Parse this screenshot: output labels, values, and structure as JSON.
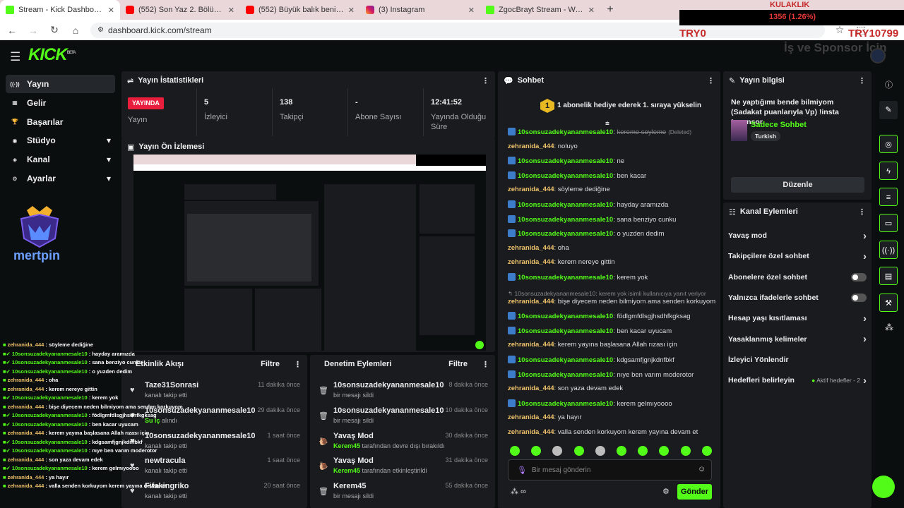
{
  "browser": {
    "tabs": [
      {
        "title": "Stream - Kick Dashboard",
        "favicon": "kick-icon",
        "active": true
      },
      {
        "title": "(552) Son Yaz 2. Bölüm | Sen Ha",
        "favicon": "youtube-icon",
        "active": false
      },
      {
        "title": "(552) Büyük balık benim. #ezel",
        "favicon": "youtube-icon",
        "active": false
      },
      {
        "title": "(3) Instagram",
        "favicon": "instagram-icon",
        "active": false
      },
      {
        "title": "ZgocBrayt Stream - Watch Live",
        "favicon": "kick-icon",
        "active": false
      }
    ],
    "url": "dashboard.kick.com/stream"
  },
  "overlay": {
    "kulaklik": "KULAKLIK",
    "counter": "1356 (1.26%)",
    "try_left": "TRY0",
    "try_right": "TRY10799",
    "sponsor_text": "İş ve Sponsor İçin"
  },
  "sidebar": {
    "items": [
      {
        "label": "Yayın",
        "icon": "broadcast-icon",
        "active": true
      },
      {
        "label": "Gelir",
        "icon": "wallet-icon"
      },
      {
        "label": "Başarılar",
        "icon": "trophy-icon"
      },
      {
        "label": "Stüdyo",
        "icon": "studio-icon",
        "expandable": true
      },
      {
        "label": "Kanal",
        "icon": "channel-icon",
        "expandable": true
      },
      {
        "label": "Ayarlar",
        "icon": "gear-icon",
        "expandable": true
      }
    ],
    "brand": "mertpin"
  },
  "stats": {
    "title": "Yayın İstatistikleri",
    "live_badge": "YAYINDA",
    "live_label": "Yayın",
    "viewers_value": "5",
    "viewers_label": "İzleyici",
    "followers_value": "138",
    "followers_label": "Takipçi",
    "subs_value": "-",
    "subs_label": "Abone Sayısı",
    "duration_value": "12:41:52",
    "duration_label": "Yayında Olduğu Süre"
  },
  "preview": {
    "title": "Yayın Ön İzlemesi"
  },
  "activity": {
    "title": "Etkinlik Akışı",
    "filter": "Filtre",
    "items": [
      {
        "name": "Taze31Sonrasi",
        "sub": "kanalı takip etti",
        "time": "11 dakika önce",
        "icon": "heart-icon"
      },
      {
        "name": "10sonsuzadekyananmesale10",
        "sub_green": "Su iç",
        "sub": " alındı",
        "time": "29 dakika önce",
        "icon": "heart-icon"
      },
      {
        "name": "10sonsuzadekyananmesale10",
        "sub": "kanalı takip etti",
        "time": "1 saat önce",
        "icon": "heart-icon"
      },
      {
        "name": "newtracula",
        "sub": "kanalı takip etti",
        "time": "1 saat önce",
        "icon": "heart-icon"
      },
      {
        "name": "Fifakingriko",
        "sub": "kanalı takip etti",
        "time": "20 saat önce",
        "icon": "heart-icon"
      }
    ]
  },
  "moderation": {
    "title": "Denetim Eylemleri",
    "filter": "Filtre",
    "items": [
      {
        "name": "10sonsuzadekyananmesale10",
        "sub": "bir mesajı sildi",
        "time": "8 dakika önce",
        "icon": "trash-icon"
      },
      {
        "name": "10sonsuzadekyananmesale10",
        "sub": "bir mesajı sildi",
        "time": "10 dakika önce",
        "icon": "trash-icon"
      },
      {
        "name": "Yavaş Mod",
        "sub_green": "Kerem45",
        "sub": " tarafından devre dışı bırakıldı",
        "time": "30 dakika önce",
        "icon": "snail-icon"
      },
      {
        "name": "Yavaş Mod",
        "sub_green": "Kerem45",
        "sub": " tarafından etkinleştirildi",
        "time": "31 dakika önce",
        "icon": "snail-icon"
      },
      {
        "name": "Kerem45",
        "sub": "bir mesajı sildi",
        "time": "55 dakika önce",
        "icon": "trash-icon"
      }
    ]
  },
  "chat": {
    "title": "Sohbet",
    "goal_number": "1",
    "goal_text": "1 abonelik hediye ederek 1. sıraya yükselin",
    "messages": [
      {
        "user": "10sonsuzadekyananmesale10",
        "badge": true,
        "text": "kereme soyleme",
        "deleted": "(Deleted)"
      },
      {
        "user": "zehranida_444",
        "text": "noluyo"
      },
      {
        "user": "10sonsuzadekyananmesale10",
        "badge": true,
        "text": "ne"
      },
      {
        "user": "10sonsuzadekyananmesale10",
        "badge": true,
        "text": "ben kacar"
      },
      {
        "user": "zehranida_444",
        "text": "söyleme dediğine"
      },
      {
        "user": "10sonsuzadekyananmesale10",
        "badge": true,
        "text": "hayday aramızda"
      },
      {
        "user": "10sonsuzadekyananmesale10",
        "badge": true,
        "text": "sana benziyo cunku"
      },
      {
        "user": "10sonsuzadekyananmesale10",
        "badge": true,
        "text": "o yuzden dedim"
      },
      {
        "user": "zehranida_444",
        "text": "oha"
      },
      {
        "user": "zehranida_444",
        "text": "kerem nereye gittin"
      },
      {
        "user": "10sonsuzadekyananmesale10",
        "badge": true,
        "text": "kerem yok"
      },
      {
        "reply": "10sonsuzadekyananmesale10: kerem yok isimli kullanıcıya yanıt veriyor"
      },
      {
        "user": "zehranida_444",
        "text": "bişe diyecem neden bilmiyom ama senden korkuyom"
      },
      {
        "user": "10sonsuzadekyananmesale10",
        "badge": true,
        "text": "födlgmfdlsgjhsdhfkgksag"
      },
      {
        "user": "10sonsuzadekyananmesale10",
        "badge": true,
        "text": "ben kacar uyucam"
      },
      {
        "user": "zehranida_444",
        "text": "kerem yayına başlasana Allah rızası için"
      },
      {
        "user": "10sonsuzadekyananmesale10",
        "badge": true,
        "text": "kdgsamfjgnjkdnfbkf"
      },
      {
        "user": "10sonsuzadekyananmesale10",
        "badge": true,
        "text": "nıye ben varım moderotor"
      },
      {
        "user": "zehranida_444",
        "text": "son yaza devam edek"
      },
      {
        "user": "10sonsuzadekyananmesale10",
        "badge": true,
        "text": "kerem gelmıyoooo"
      },
      {
        "user": "zehranida_444",
        "text": "ya hayır"
      },
      {
        "user": "zehranida_444",
        "text": "valla senden korkuyom kerem yayına devam et"
      }
    ],
    "input_placeholder": "Bir mesaj gönderin",
    "send_label": "Gönder"
  },
  "stream_info": {
    "title": "Yayın bilgisi",
    "stream_title": "Ne yaptığımı bende bilmiyom (Sadakat puanlarıyla Vp) !insta !sponsor",
    "category": "Sadece Sohbet",
    "language": "Turkish",
    "edit_label": "Düzenle"
  },
  "channel_actions": {
    "title": "Kanal Eylemleri",
    "items": [
      {
        "label": "Yavaş mod",
        "control": "chevron"
      },
      {
        "label": "Takipçilere özel sohbet",
        "control": "chevron"
      },
      {
        "label": "Abonelere özel sohbet",
        "control": "toggle"
      },
      {
        "label": "Yalnızca ifadelerle sohbet",
        "control": "toggle"
      },
      {
        "label": "Hesap yaşı kısıtlaması",
        "control": "chevron"
      },
      {
        "label": "Yasaklanmış kelimeler",
        "control": "chevron"
      },
      {
        "label": "İzleyici Yönlendir",
        "control": "none"
      },
      {
        "label": "Hedefleri belirleyin",
        "control": "chevron",
        "extra": "Aktif hedefler - 2"
      }
    ]
  },
  "overlay_chat": [
    {
      "user": "zehranida_444",
      "text": "söyleme dediğine"
    },
    {
      "user": "10sonsuzadekyananmesale10",
      "text": "hayday aramızda"
    },
    {
      "user": "10sonsuzadekyananmesale10",
      "text": "sana benziyo cunku"
    },
    {
      "user": "10sonsuzadekyananmesale10",
      "text": "o yuzden dedim"
    },
    {
      "user": "zehranida_444",
      "text": "oha"
    },
    {
      "user": "zehranida_444",
      "text": "kerem nereye gittin"
    },
    {
      "user": "10sonsuzadekyananmesale10",
      "text": "kerem yok"
    },
    {
      "user": "zehranida_444",
      "text": "bişe diyecem neden bilmiyom ama senden korkuyom"
    },
    {
      "user": "10sonsuzadekyananmesale10",
      "text": "födlgmfdlsgjhsdhfkgksag"
    },
    {
      "user": "10sonsuzadekyananmesale10",
      "text": "ben kacar uyucam"
    },
    {
      "user": "zehranida_444",
      "text": "kerem yayına başlasana Allah rızası için"
    },
    {
      "user": "10sonsuzadekyananmesale10",
      "text": "kdgsamfjgnjkdnfbkf"
    },
    {
      "user": "10sonsuzadekyananmesale10",
      "text": "nıye ben varım moderotor"
    },
    {
      "user": "zehranida_444",
      "text": "son yaza devam edek"
    },
    {
      "user": "10sonsuzadekyananmesale10",
      "text": "kerem gelmıyoooo"
    },
    {
      "user": "zehranida_444",
      "text": "ya hayır"
    },
    {
      "user": "zehranida_444",
      "text": "valla senden korkuyom kerem yayına devam et"
    }
  ],
  "colors": {
    "accent": "#53fc18",
    "live": "#e91e3c",
    "user_alt": "#f0c36b"
  }
}
